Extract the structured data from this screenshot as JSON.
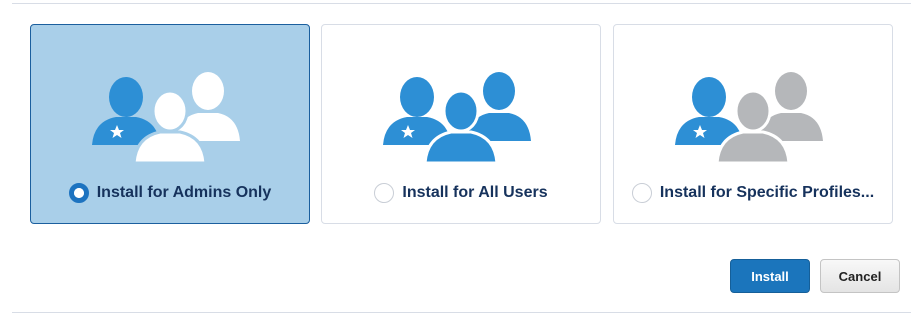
{
  "options": [
    {
      "label": "Install for Admins Only",
      "selected": true,
      "icon": "admins-only-icon"
    },
    {
      "label": "Install for All Users",
      "selected": false,
      "icon": "all-users-icon"
    },
    {
      "label": "Install for Specific Profiles...",
      "selected": false,
      "icon": "specific-profiles-icon"
    }
  ],
  "buttons": {
    "install_label": "Install",
    "cancel_label": "Cancel"
  },
  "colors": {
    "selected_card_bg": "#a9cfe9",
    "selected_card_border": "#1b5f9e",
    "user_blue": "#2d8fd5",
    "user_gray": "#b5b7ba",
    "user_white": "#ffffff",
    "install_button": "#1b75bc",
    "label_text": "#16325c"
  }
}
